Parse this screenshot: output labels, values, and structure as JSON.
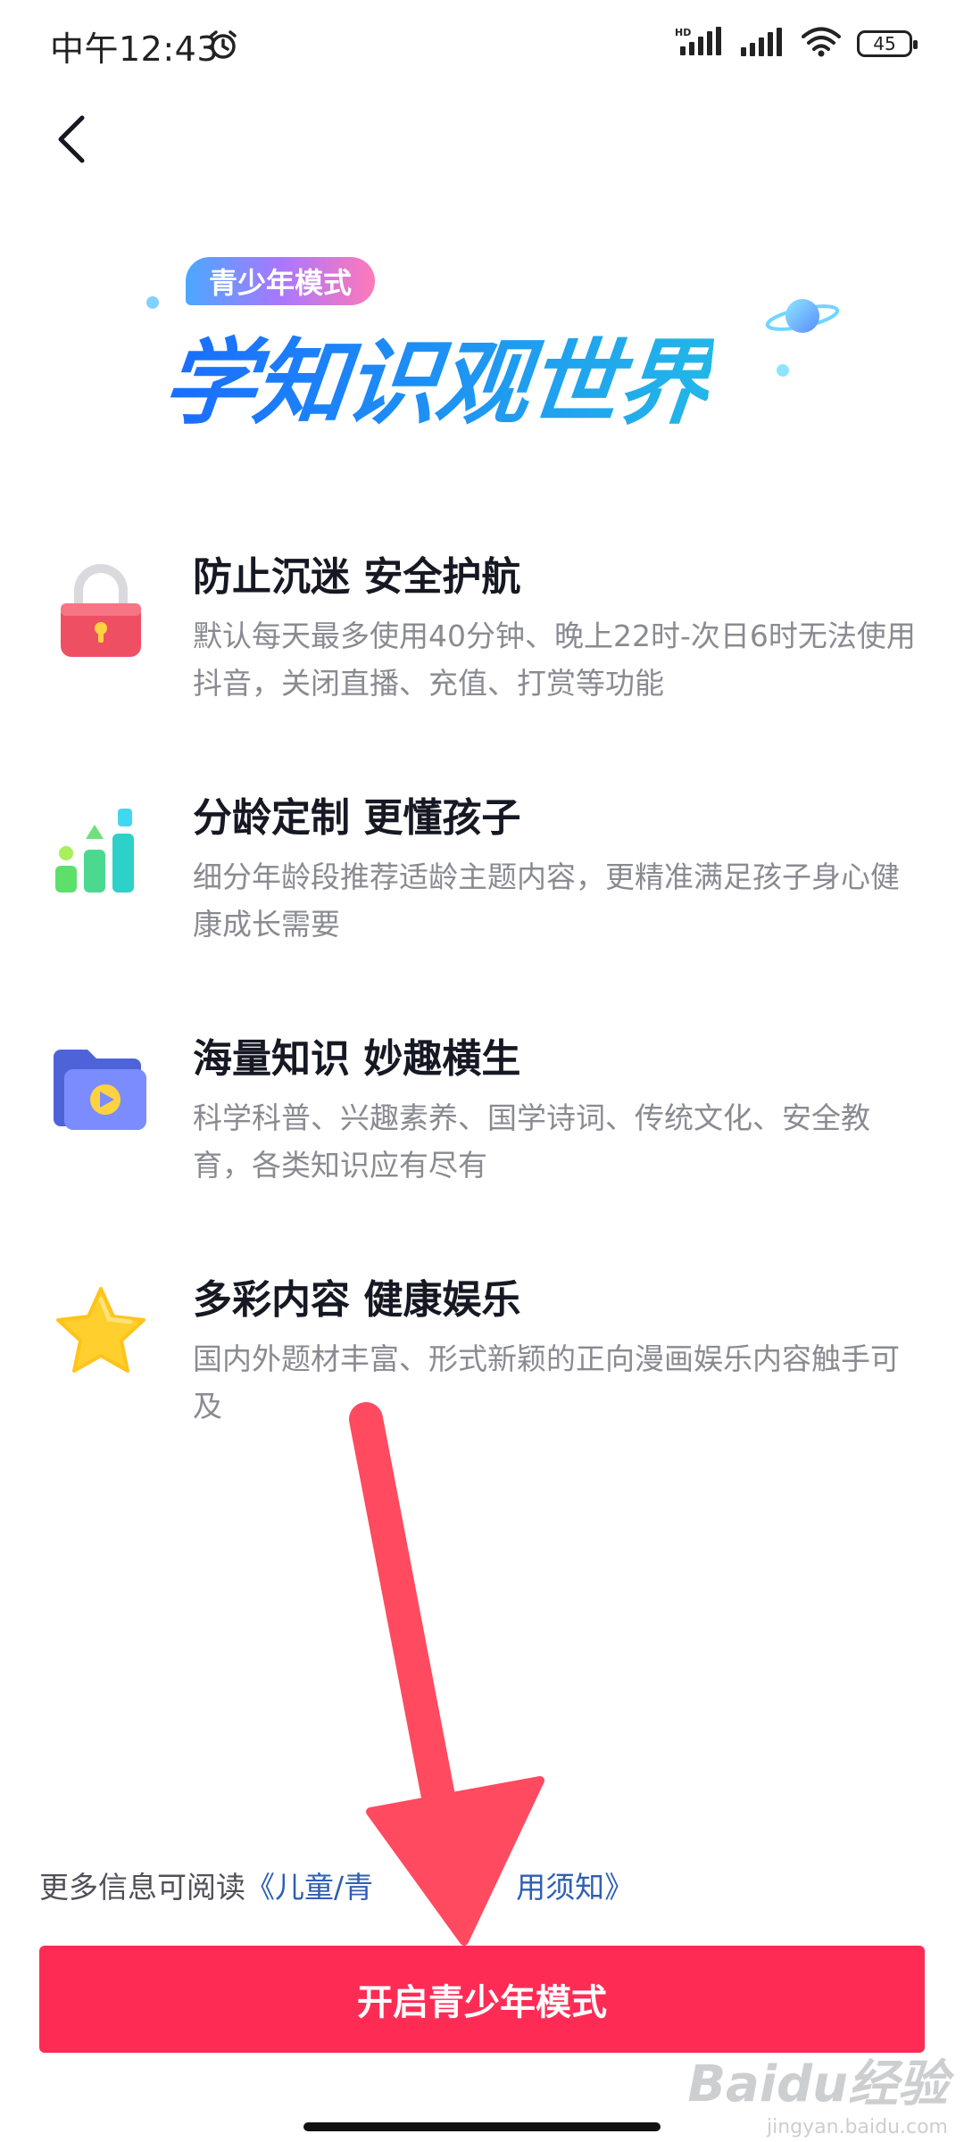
{
  "status_bar": {
    "time": "中午12:43",
    "network_label": "HD",
    "battery": "45"
  },
  "hero": {
    "badge": "青少年模式",
    "title": "学知识观世界"
  },
  "features": [
    {
      "icon": "lock-icon",
      "title": "防止沉迷 安全护航",
      "description": "默认每天最多使用40分钟、晚上22时-次日6时无法使用抖音，关闭直播、充值、打赏等功能"
    },
    {
      "icon": "bar-chart-icon",
      "title": "分龄定制 更懂孩子",
      "description": "细分年龄段推荐适龄主题内容，更精准满足孩子身心健康成长需要"
    },
    {
      "icon": "video-folder-icon",
      "title": "海量知识 妙趣横生",
      "description": "科学科普、兴趣素养、国学诗词、传统文化、安全教育，各类知识应有尽有"
    },
    {
      "icon": "star-icon",
      "title": "多彩内容 健康娱乐",
      "description": "国内外题材丰富、形式新颖的正向漫画娱乐内容触手可及"
    }
  ],
  "footer": {
    "more_info_prefix": "更多信息可阅读",
    "more_info_link": "《儿童/青",
    "more_info_link_tail": "用须知》",
    "primary_button": "开启青少年模式"
  },
  "watermark": {
    "main": "Baidu经验",
    "sub": "jingyan.baidu.com"
  },
  "colors": {
    "accent": "#fe2c55",
    "link": "#2f5fb3",
    "annotation_arrow": "#ff4a5f"
  }
}
